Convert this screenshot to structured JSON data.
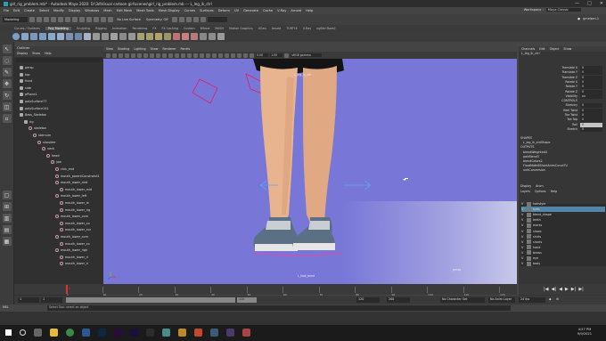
{
  "title_bar": {
    "text": "girl_rig_problem.mb* - Autodesk Maya 2020: D:\\3d\\Visual cartoon girl\\scenes\\girl_rig_problem.mb --- L_leg_ik_ctrl",
    "window_buttons": [
      "—",
      "□",
      "✕"
    ]
  },
  "menubar": {
    "items": [
      "File",
      "Edit",
      "Create",
      "Select",
      "Modify",
      "Display",
      "Windows",
      "Mesh",
      "Edit Mesh",
      "Mesh Tools",
      "Mesh Display",
      "Curves",
      "Surfaces",
      "Deform",
      "UV",
      "Generate",
      "Cache",
      "V-Ray",
      "Arnold",
      "Help"
    ],
    "workspace_label": "Workspace :",
    "workspace_value": "Maya Classic"
  },
  "status_line": {
    "mode": "Modeling",
    "no_live_surface": "No Live Surface",
    "symmetry": "Symmetry: Off",
    "sign_in": "gmelsen-1",
    "search_value": ""
  },
  "shelf": {
    "tabs": [
      "Curves / Surfaces",
      "Poly Modeling",
      "Sculpting",
      "Rigging",
      "Animation",
      "Rendering",
      "FX",
      "FX Caching",
      "Custom",
      "Bifrost",
      "MASH",
      "Motion Graphics",
      "XGen",
      "Arnold",
      "TURTLE",
      "V-Ray",
      "ngSkinTools2"
    ],
    "active_tab": "Poly Modeling"
  },
  "toolbox": {
    "tools": [
      "select-tool",
      "lasso-tool",
      "paint-tool",
      "move-tool",
      "rotate-tool",
      "scale-tool",
      "last-tool"
    ]
  },
  "outliner": {
    "title": "Outliner",
    "menu": [
      "Display",
      "Show",
      "Help"
    ],
    "rows": [
      {
        "label": "persp",
        "indent": 0,
        "type": "cam"
      },
      {
        "label": "top",
        "indent": 0,
        "type": "cam"
      },
      {
        "label": "front",
        "indent": 0,
        "type": "cam"
      },
      {
        "label": "side",
        "indent": 0,
        "type": "cam"
      },
      {
        "label": "pPlane1",
        "indent": 0,
        "type": "mesh"
      },
      {
        "label": "polySurface77",
        "indent": 0,
        "type": "mesh"
      },
      {
        "label": "polySurface141",
        "indent": 0,
        "type": "mesh"
      },
      {
        "label": "Bass_Skeleton",
        "indent": 0,
        "type": "group"
      },
      {
        "label": "rig",
        "indent": 1,
        "type": "group"
      },
      {
        "label": "skeleton",
        "indent": 2,
        "type": "joint"
      },
      {
        "label": "sternum",
        "indent": 3,
        "type": "joint"
      },
      {
        "label": "shoulder",
        "indent": 4,
        "type": "joint"
      },
      {
        "label": "neck",
        "indent": 5,
        "type": "joint"
      },
      {
        "label": "head",
        "indent": 6,
        "type": "joint"
      },
      {
        "label": "jaw",
        "indent": 7,
        "type": "joint"
      },
      {
        "label": "chin_end",
        "indent": 8,
        "type": "joint"
      },
      {
        "label": "mouth_parentConstraint1",
        "indent": 8,
        "type": "joint"
      },
      {
        "label": "mouth_lower_mid",
        "indent": 8,
        "type": "joint"
      },
      {
        "label": "mouth_lower_mid",
        "indent": 9,
        "type": "joint"
      },
      {
        "label": "mouth_lower_left",
        "indent": 8,
        "type": "joint"
      },
      {
        "label": "mouth_lower_le",
        "indent": 9,
        "type": "joint"
      },
      {
        "label": "mouth_lower_rig",
        "indent": 9,
        "type": "joint"
      },
      {
        "label": "mouth_lower_corn",
        "indent": 8,
        "type": "joint"
      },
      {
        "label": "mouth_lower_co",
        "indent": 9,
        "type": "joint"
      },
      {
        "label": "mouth_lower_cor",
        "indent": 9,
        "type": "joint"
      },
      {
        "label": "mouth_lower_corn",
        "indent": 8,
        "type": "joint"
      },
      {
        "label": "mouth_lower_co",
        "indent": 9,
        "type": "joint"
      },
      {
        "label": "mouth_lower_righ",
        "indent": 8,
        "type": "joint"
      },
      {
        "label": "mouth_lower_ri",
        "indent": 9,
        "type": "joint"
      },
      {
        "label": "mouth_lower_ri",
        "indent": 9,
        "type": "joint"
      }
    ]
  },
  "viewport": {
    "menu": [
      "View",
      "Shading",
      "Lighting",
      "Show",
      "Renderer",
      "Panels"
    ],
    "toolbar_values": [
      "0.00",
      "1.00",
      "sRGB gamma"
    ],
    "label_top": "L_leg_ik_ctrl",
    "label_bottom": "L_foot_bend",
    "camera": "persp",
    "colors": {
      "background": "#7877d8",
      "skin": "#e8b48f",
      "shorts": "#141414",
      "shoe": "#5b6f85"
    }
  },
  "channel_box": {
    "tabs": [
      "Channels",
      "Edit",
      "Object",
      "Show"
    ],
    "node_name": "L_leg_ik_ctrl",
    "attributes": [
      {
        "name": "Translate X",
        "value": "0"
      },
      {
        "name": "Translate Y",
        "value": "0"
      },
      {
        "name": "Translate Z",
        "value": "0"
      },
      {
        "name": "Rotate X",
        "value": "0"
      },
      {
        "name": "Rotate Y",
        "value": "0"
      },
      {
        "name": "Rotate Z",
        "value": "0"
      },
      {
        "name": "Visibility",
        "value": "on"
      },
      {
        "name": "CONTROLS",
        "value": ""
      },
      {
        "name": "Stretchy",
        "value": "0"
      },
      {
        "name": "Heel Twist",
        "value": "0"
      },
      {
        "name": "Toe Twist",
        "value": "0"
      },
      {
        "name": "Toe Tap",
        "value": "0"
      },
      {
        "name": "Roll",
        "value": "0"
      },
      {
        "name": "Stretch",
        "value": "0"
      }
    ],
    "shapes_title": "SHAPES",
    "shapes": [
      "L_leg_ik_ctrlShape"
    ],
    "outputs_title": "OUTPUTS",
    "outputs": [
      "blendWeighted4",
      "pairBlend3",
      "blendColors2",
      "FloatMath6ShortAnimCurveTU",
      "unitConversion"
    ],
    "layer_tabs": [
      "Display",
      "Anim"
    ],
    "layer_menu": [
      "Layers",
      "Options",
      "Help"
    ],
    "layers": [
      {
        "name": "hairstyle",
        "visible": "V",
        "selected": false
      },
      {
        "name": "eyes",
        "visible": "V",
        "selected": true
      },
      {
        "name": "blend_shape",
        "visible": "V",
        "selected": false
      },
      {
        "name": "teeth",
        "visible": "V",
        "selected": false
      },
      {
        "name": "marks",
        "visible": "V",
        "selected": false
      },
      {
        "name": "shoes",
        "visible": "V",
        "selected": false
      },
      {
        "name": "shirts",
        "visible": "V",
        "selected": false
      },
      {
        "name": "shorts",
        "visible": "V",
        "selected": false
      },
      {
        "name": "hand",
        "visible": "V",
        "selected": false
      },
      {
        "name": "brows",
        "visible": "V",
        "selected": false
      },
      {
        "name": "eye",
        "visible": "V",
        "selected": false
      },
      {
        "name": "body",
        "visible": "V",
        "selected": false
      }
    ]
  },
  "time_slider": {
    "ticks": [
      "1",
      "10",
      "20",
      "30",
      "40",
      "50",
      "60",
      "70",
      "80",
      "90",
      "100",
      "110",
      "120"
    ],
    "current_frame": "1",
    "playback_icons": [
      "|◀",
      "◀|",
      "◀",
      "▶",
      "▶|",
      "▶|"
    ]
  },
  "range_slider": {
    "start": "1",
    "range_start": "1",
    "range_end": "120",
    "end": "120",
    "max": "200",
    "character_set": "No Character Set",
    "anim_layer": "No Anim Layer",
    "fps": "24 fps"
  },
  "help_line": {
    "mel_label": "MEL",
    "text": "Select Tool: select an object"
  },
  "taskbar": {
    "time": "4:57 PM",
    "date": "9/9/2021",
    "apps": [
      "start",
      "search",
      "task-view",
      "file-explorer",
      "chrome",
      "word",
      "ps",
      "premiere",
      "ae",
      "maya",
      "vlc",
      "zbrush",
      "steam",
      "extra"
    ]
  }
}
